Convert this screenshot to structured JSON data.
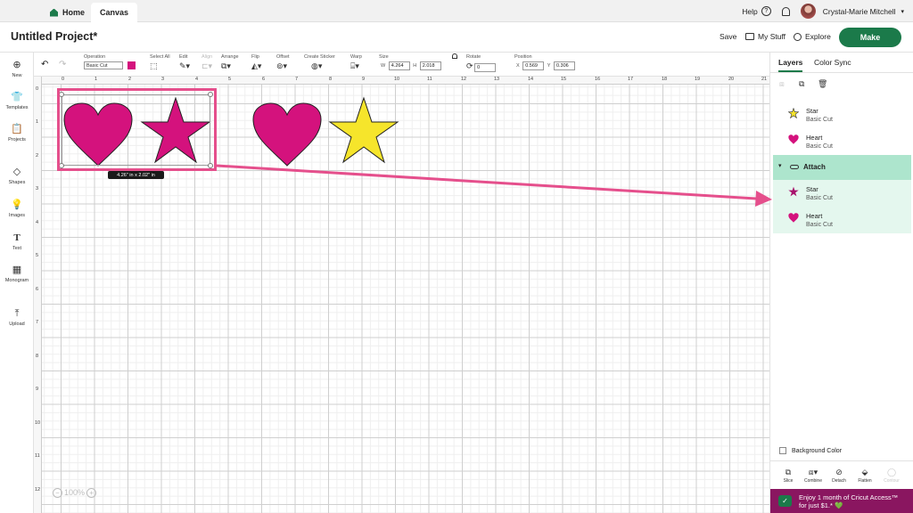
{
  "topbar": {
    "tabs": [
      {
        "label": "Home"
      },
      {
        "label": "Canvas"
      }
    ],
    "help": "Help",
    "help_icon": "?",
    "user_name": "Crystal-Marie Mitchell"
  },
  "header": {
    "project_title": "Untitled Project*",
    "save": "Save",
    "my_stuff": "My Stuff",
    "explore": "Explore",
    "make": "Make"
  },
  "toolbar": {
    "operation_label": "Operation",
    "operation_value": "Basic Cut",
    "operation_color": "#d4127d",
    "select_all": "Select All",
    "edit": "Edit",
    "align": "Align",
    "arrange": "Arrange",
    "flip": "Flip",
    "offset": "Offset",
    "create_sticker": "Create Sticker",
    "warp": "Warp",
    "size_label": "Size",
    "w_label": "W",
    "w_value": "4.264",
    "h_label": "H",
    "h_value": "2.018",
    "rotate_label": "Rotate",
    "rotate_value": "0",
    "position_label": "Position",
    "x_label": "X",
    "x_value": "0.569",
    "y_label": "Y",
    "y_value": "0.306"
  },
  "sidebar": {
    "items": [
      {
        "label": "New",
        "icon": "plus-circle-icon"
      },
      {
        "label": "Templates",
        "icon": "shirt-icon"
      },
      {
        "label": "Projects",
        "icon": "clipboard-icon"
      },
      {
        "label": "Shapes",
        "icon": "shapes-icon"
      },
      {
        "label": "Images",
        "icon": "lightbulb-icon"
      },
      {
        "label": "Text",
        "icon": "text-icon"
      },
      {
        "label": "Monogram",
        "icon": "monogram-icon"
      },
      {
        "label": "Upload",
        "icon": "upload-icon"
      }
    ]
  },
  "canvas": {
    "ruler_top": [
      "0",
      "1",
      "2",
      "3",
      "4",
      "5",
      "6",
      "7",
      "8",
      "9",
      "10",
      "11",
      "12",
      "13",
      "14",
      "15",
      "16",
      "17",
      "18",
      "19",
      "20",
      "21",
      "2"
    ],
    "ruler_left": [
      "0",
      "1",
      "2",
      "3",
      "4",
      "5",
      "6",
      "7",
      "8",
      "9",
      "10",
      "11",
      "12",
      "13"
    ],
    "selection_dimensions": "4.26\" in x 2.02\" in",
    "zoom_minus": "−",
    "zoom": "100%",
    "zoom_plus": "+",
    "shapes": [
      {
        "type": "heart",
        "color": "#d4127d"
      },
      {
        "type": "star",
        "color": "#d4127d"
      },
      {
        "type": "heart",
        "color": "#d4127d"
      },
      {
        "type": "star",
        "color": "#f6e52b"
      }
    ],
    "highlight_color": "#e54f8c"
  },
  "layers_panel": {
    "tabs": [
      {
        "label": "Layers"
      },
      {
        "label": "Color Sync"
      }
    ],
    "layers": [
      {
        "name": "Star",
        "operation": "Basic Cut",
        "shape": "star",
        "color": "#f6e52b"
      },
      {
        "name": "Heart",
        "operation": "Basic Cut",
        "shape": "heart",
        "color": "#d4127d"
      }
    ],
    "group": {
      "name": "Attach",
      "children": [
        {
          "name": "Star",
          "operation": "Basic Cut",
          "shape": "star",
          "color": "#a8136d"
        },
        {
          "name": "Heart",
          "operation": "Basic Cut",
          "shape": "heart",
          "color": "#d4127d"
        }
      ]
    },
    "background_color": "Background Color",
    "actions": [
      "Slice",
      "Combine",
      "Detach",
      "Flatten",
      "Contour"
    ],
    "promo_line1": "Enjoy 1 month of Cricut Access™",
    "promo_line2": "for just $1.* 💚"
  },
  "colors": {
    "brand_green": "#1b7a4a",
    "attach_group_bg": "#ade5cd",
    "attach_child_bg": "#e4f7ee",
    "promo_bg": "#8a1660"
  }
}
